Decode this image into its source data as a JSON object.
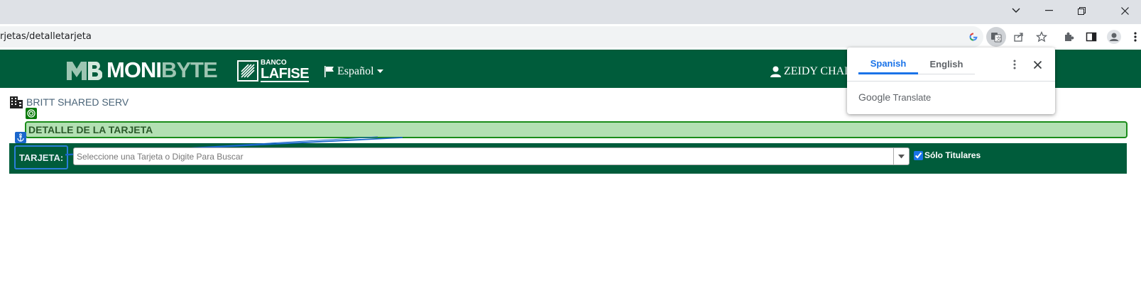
{
  "browser": {
    "url": "rjetas/detalletarjeta"
  },
  "header": {
    "logo_left": "MONI",
    "logo_right": "BYTE",
    "partner_small": "BANCO",
    "partner_name": "LAFISE",
    "language": "Español",
    "user": "ZEIDY CHAL"
  },
  "company": {
    "name": "BRITT SHARED SERV"
  },
  "section": {
    "title": "DETALLE DE LA TARJETA"
  },
  "card_filter": {
    "label": "TARJETA:",
    "placeholder": "Seleccione una Tarjeta o Digite Para Buscar",
    "holders_only": "Sólo Titulares",
    "holders_only_checked": true
  },
  "translate_popup": {
    "tab_source": "Spanish",
    "tab_target": "English",
    "brand_google": "Google",
    "brand_translate": "Translate"
  },
  "colors": {
    "header_green": "#005c3b",
    "section_bg": "#b3e0b3",
    "accent_blue": "#1a73e8"
  }
}
